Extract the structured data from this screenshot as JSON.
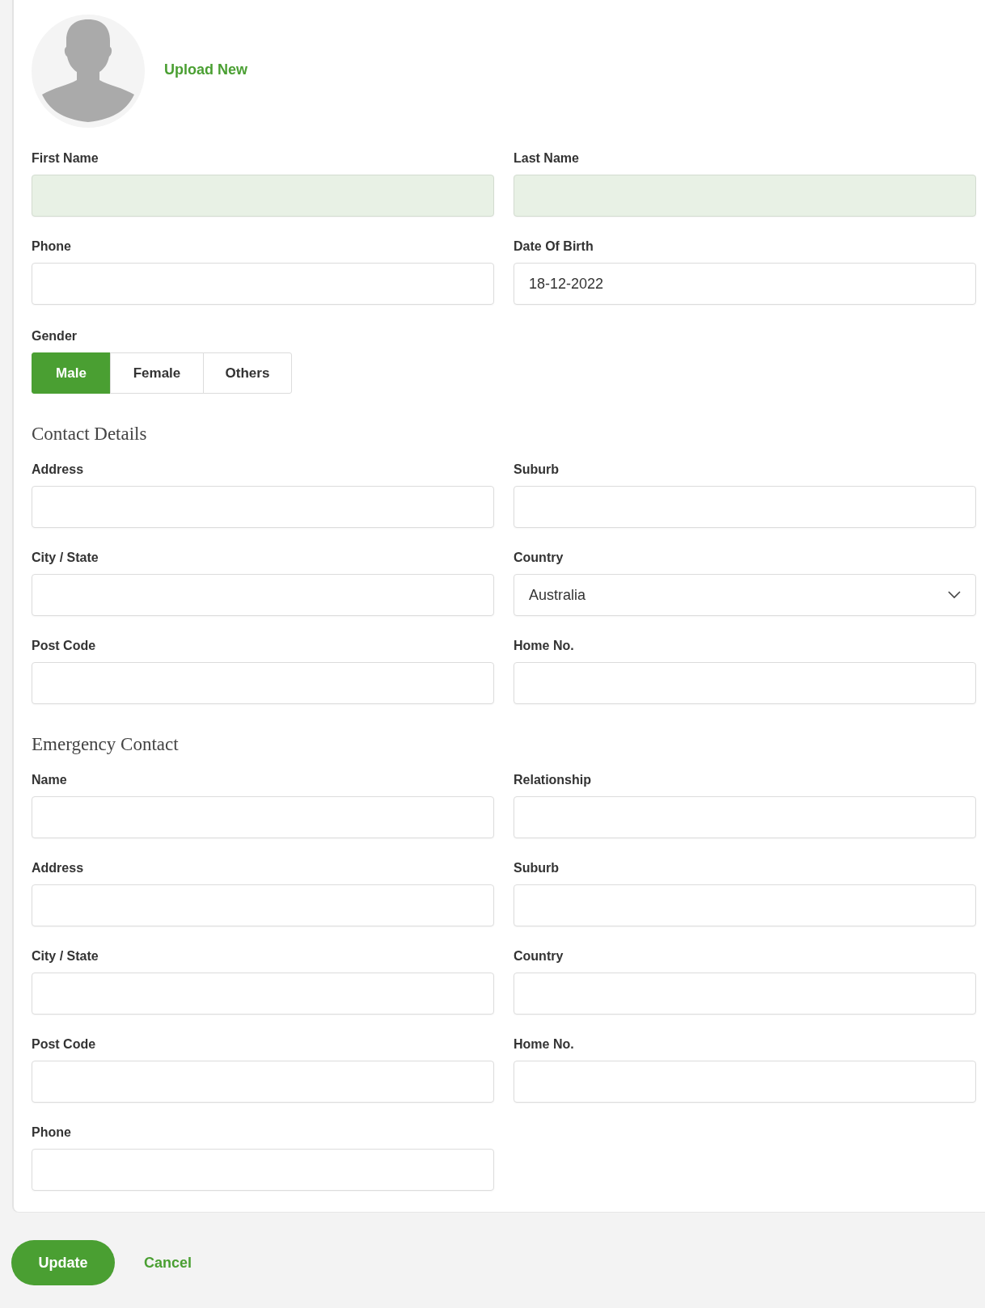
{
  "avatar": {
    "upload_link": "Upload New"
  },
  "profile_fields": [
    {
      "label": "First Name",
      "readonly": true
    },
    {
      "label": "Last Name",
      "readonly": true
    },
    {
      "label": "Phone",
      "readonly": false
    },
    {
      "label": "Date Of Birth",
      "readonly": false,
      "value": "18-12-2022"
    }
  ],
  "gender": {
    "label": "Gender",
    "options": [
      {
        "label": "Male",
        "selected": true
      },
      {
        "label": "Female",
        "selected": false
      },
      {
        "label": "Others",
        "selected": false
      }
    ]
  },
  "contact_details": {
    "title": "Contact Details",
    "fields": [
      {
        "label": "Address",
        "kind": "text"
      },
      {
        "label": "Suburb",
        "kind": "text"
      },
      {
        "label": "City / State",
        "kind": "text"
      },
      {
        "label": "Country",
        "kind": "select",
        "value": "Australia"
      },
      {
        "label": "Post Code",
        "kind": "text"
      },
      {
        "label": "Home No.",
        "kind": "text"
      }
    ]
  },
  "emergency_contact": {
    "title": "Emergency Contact",
    "fields": [
      {
        "label": "Name",
        "kind": "text"
      },
      {
        "label": "Relationship",
        "kind": "text"
      },
      {
        "label": "Address",
        "kind": "text"
      },
      {
        "label": "Suburb",
        "kind": "text"
      },
      {
        "label": "City / State",
        "kind": "text"
      },
      {
        "label": "Country",
        "kind": "text"
      },
      {
        "label": "Post Code",
        "kind": "text"
      },
      {
        "label": "Home No.",
        "kind": "text"
      },
      {
        "label": "Phone",
        "kind": "text"
      }
    ]
  },
  "actions": [
    {
      "label": "Update",
      "kind": "primary"
    },
    {
      "label": "Cancel",
      "kind": "link"
    }
  ]
}
